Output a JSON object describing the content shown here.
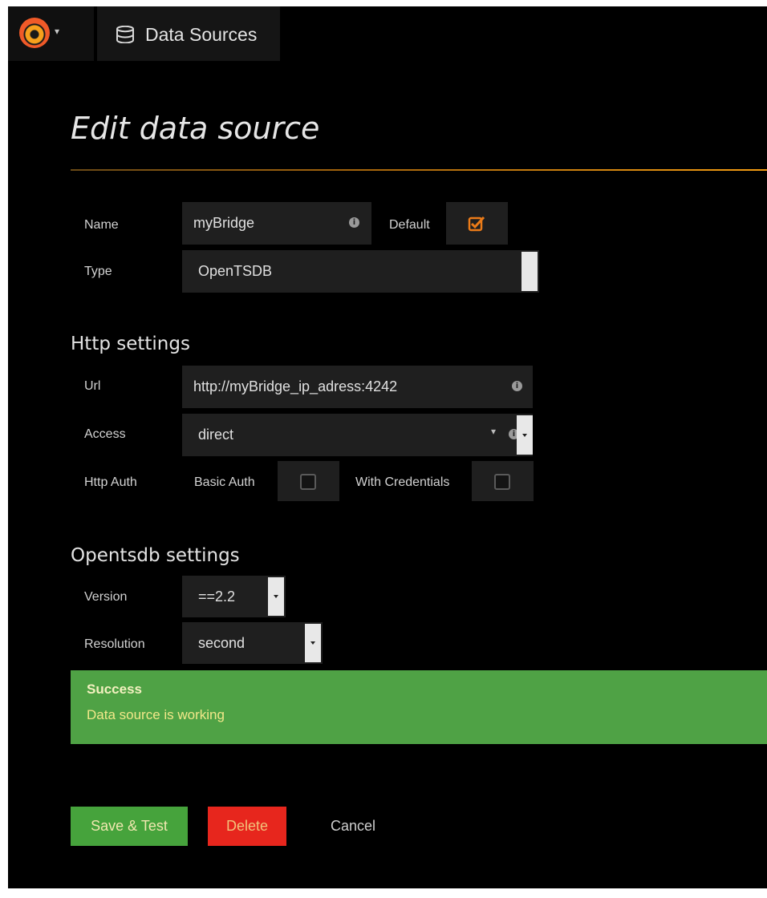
{
  "topbar": {
    "logo": "grafana-logo",
    "section_icon": "database-icon",
    "section_title": "Data Sources"
  },
  "page": {
    "title": "Edit data source"
  },
  "form": {
    "name_label": "Name",
    "name_value": "myBridge",
    "default_label": "Default",
    "default_checked": true,
    "type_label": "Type",
    "type_value": "OpenTSDB"
  },
  "http": {
    "heading": "Http settings",
    "url_label": "Url",
    "url_value": "http://myBridge_ip_adress:4242",
    "access_label": "Access",
    "access_value": "direct",
    "auth_label": "Http Auth",
    "basic_auth_label": "Basic Auth",
    "basic_auth_checked": false,
    "with_credentials_label": "With Credentials",
    "with_credentials_checked": false
  },
  "opentsdb": {
    "heading": "Opentsdb settings",
    "version_label": "Version",
    "version_value": "==2.2",
    "resolution_label": "Resolution",
    "resolution_value": "second"
  },
  "alert": {
    "title": "Success",
    "message": "Data source is working",
    "color": "#4fa245"
  },
  "actions": {
    "save_label": "Save & Test",
    "delete_label": "Delete",
    "cancel_label": "Cancel"
  },
  "colors": {
    "accent": "#f39c12",
    "background": "#000000",
    "field": "#1f1f1f",
    "save": "#46a33c",
    "delete": "#e7261d"
  }
}
